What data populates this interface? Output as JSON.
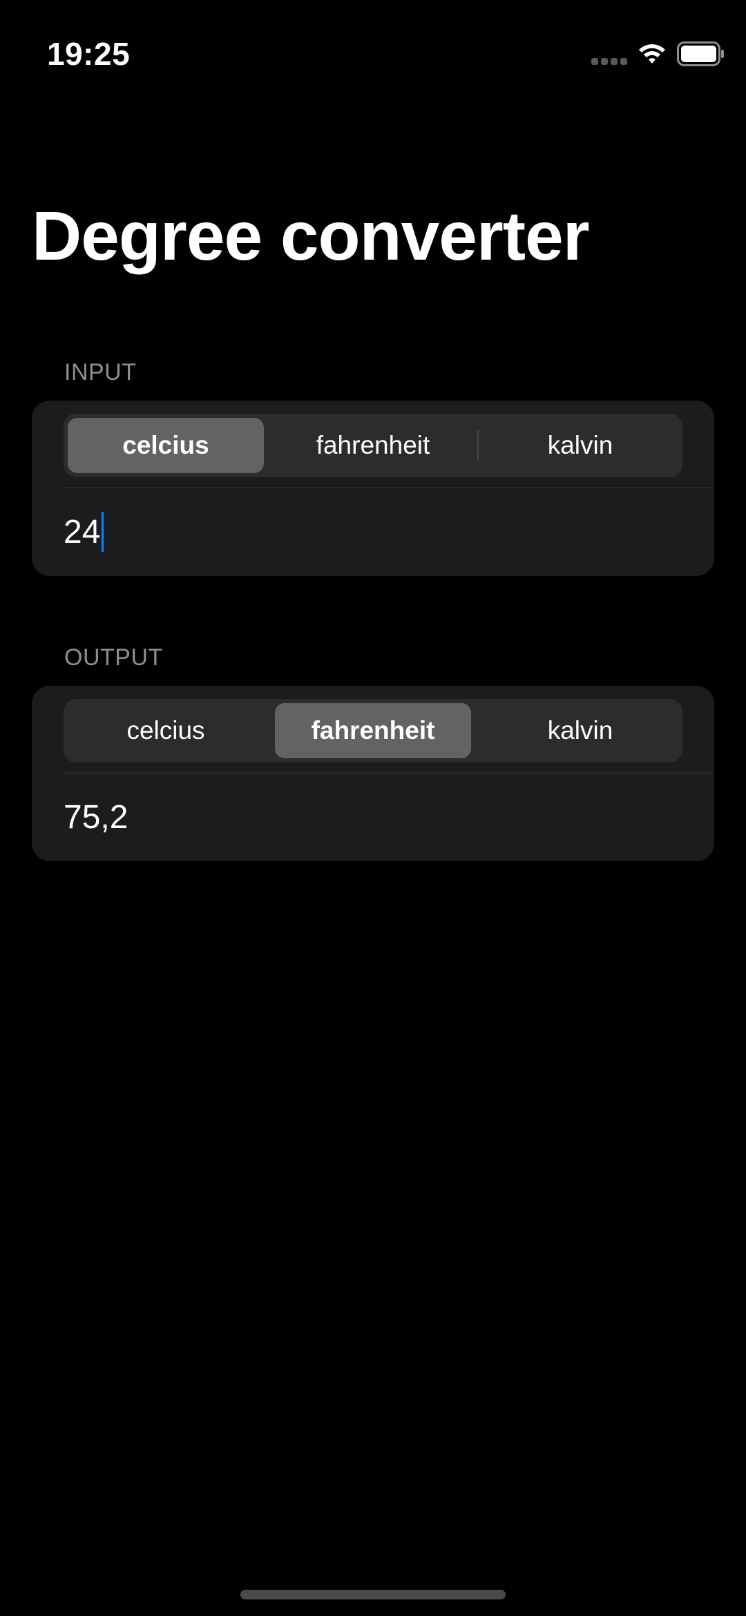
{
  "status_bar": {
    "time": "19:25",
    "icons": [
      "signal-icon",
      "wifi-icon",
      "battery-icon"
    ]
  },
  "title": "Degree converter",
  "input": {
    "header": "INPUT",
    "segments": [
      "celcius",
      "fahrenheit",
      "kalvin"
    ],
    "selected_segment": "celcius",
    "value": "24"
  },
  "output": {
    "header": "OUTPUT",
    "segments": [
      "celcius",
      "fahrenheit",
      "kalvin"
    ],
    "selected_segment": "fahrenheit",
    "value": "75,2"
  },
  "colors": {
    "background": "#000000",
    "card": "#1c1c1e",
    "segmented_track": "#2c2c2e",
    "segment_selected": "#636366",
    "secondary_text": "#8e8e93",
    "caret": "#0a84ff"
  }
}
